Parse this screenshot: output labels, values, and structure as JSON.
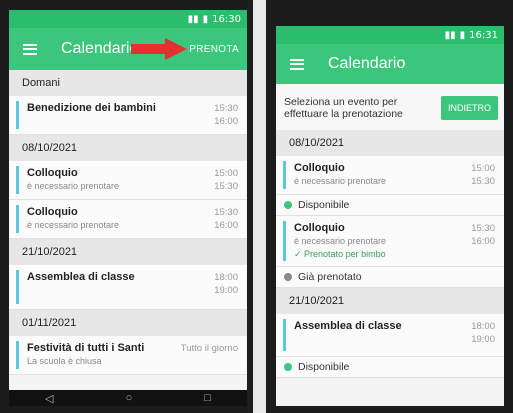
{
  "phone1": {
    "status_time": "16:30",
    "title": "Calendario",
    "action": "PRENOTA",
    "sections": [
      {
        "date": "Domani",
        "events": [
          {
            "title": "Benedizione dei bambini",
            "subtitle": "",
            "start": "15:30",
            "end": "16:00"
          }
        ]
      },
      {
        "date": "08/10/2021",
        "events": [
          {
            "title": "Colloquio",
            "subtitle": "è necessario prenotare",
            "start": "15:00",
            "end": "15:30"
          },
          {
            "title": "Colloquio",
            "subtitle": "è necessario prenotare",
            "start": "15:30",
            "end": "16:00"
          }
        ]
      },
      {
        "date": "21/10/2021",
        "events": [
          {
            "title": "Assemblea di classe",
            "subtitle": "",
            "start": "18:00",
            "end": "19:00"
          }
        ]
      },
      {
        "date": "01/11/2021",
        "events": [
          {
            "title": "Festività di tutti i Santi",
            "subtitle": "La scuola è chiusa",
            "start": "Tutto il giorno",
            "end": ""
          }
        ]
      }
    ]
  },
  "phone2": {
    "status_time": "16:31",
    "title": "Calendario",
    "banner": "Seleziona un evento per effettuare la prenotazione",
    "back_label": "INDIETRO",
    "sections": [
      {
        "date": "08/10/2021",
        "events": [
          {
            "title": "Colloquio",
            "subtitle": "è necessario prenotare",
            "booked": "",
            "start": "15:00",
            "end": "15:30",
            "status": "Disponibile",
            "status_color": "#3cc67c"
          },
          {
            "title": "Colloquio",
            "subtitle": "è necessario prenotare",
            "booked": "✓ Prenotato per bimbo",
            "start": "15:30",
            "end": "16:00",
            "status": "Già prenotato",
            "status_color": "#8a8a8a"
          }
        ]
      },
      {
        "date": "21/10/2021",
        "events": [
          {
            "title": "Assemblea di classe",
            "subtitle": "",
            "booked": "",
            "start": "18:00",
            "end": "19:00",
            "status": "Disponibile",
            "status_color": "#3cc67c"
          }
        ]
      }
    ]
  },
  "colors": {
    "accent": "#3cc67c",
    "status_bar": "#2bbd6e",
    "event_bar": "#5bc6de",
    "arrow": "#e53030"
  }
}
